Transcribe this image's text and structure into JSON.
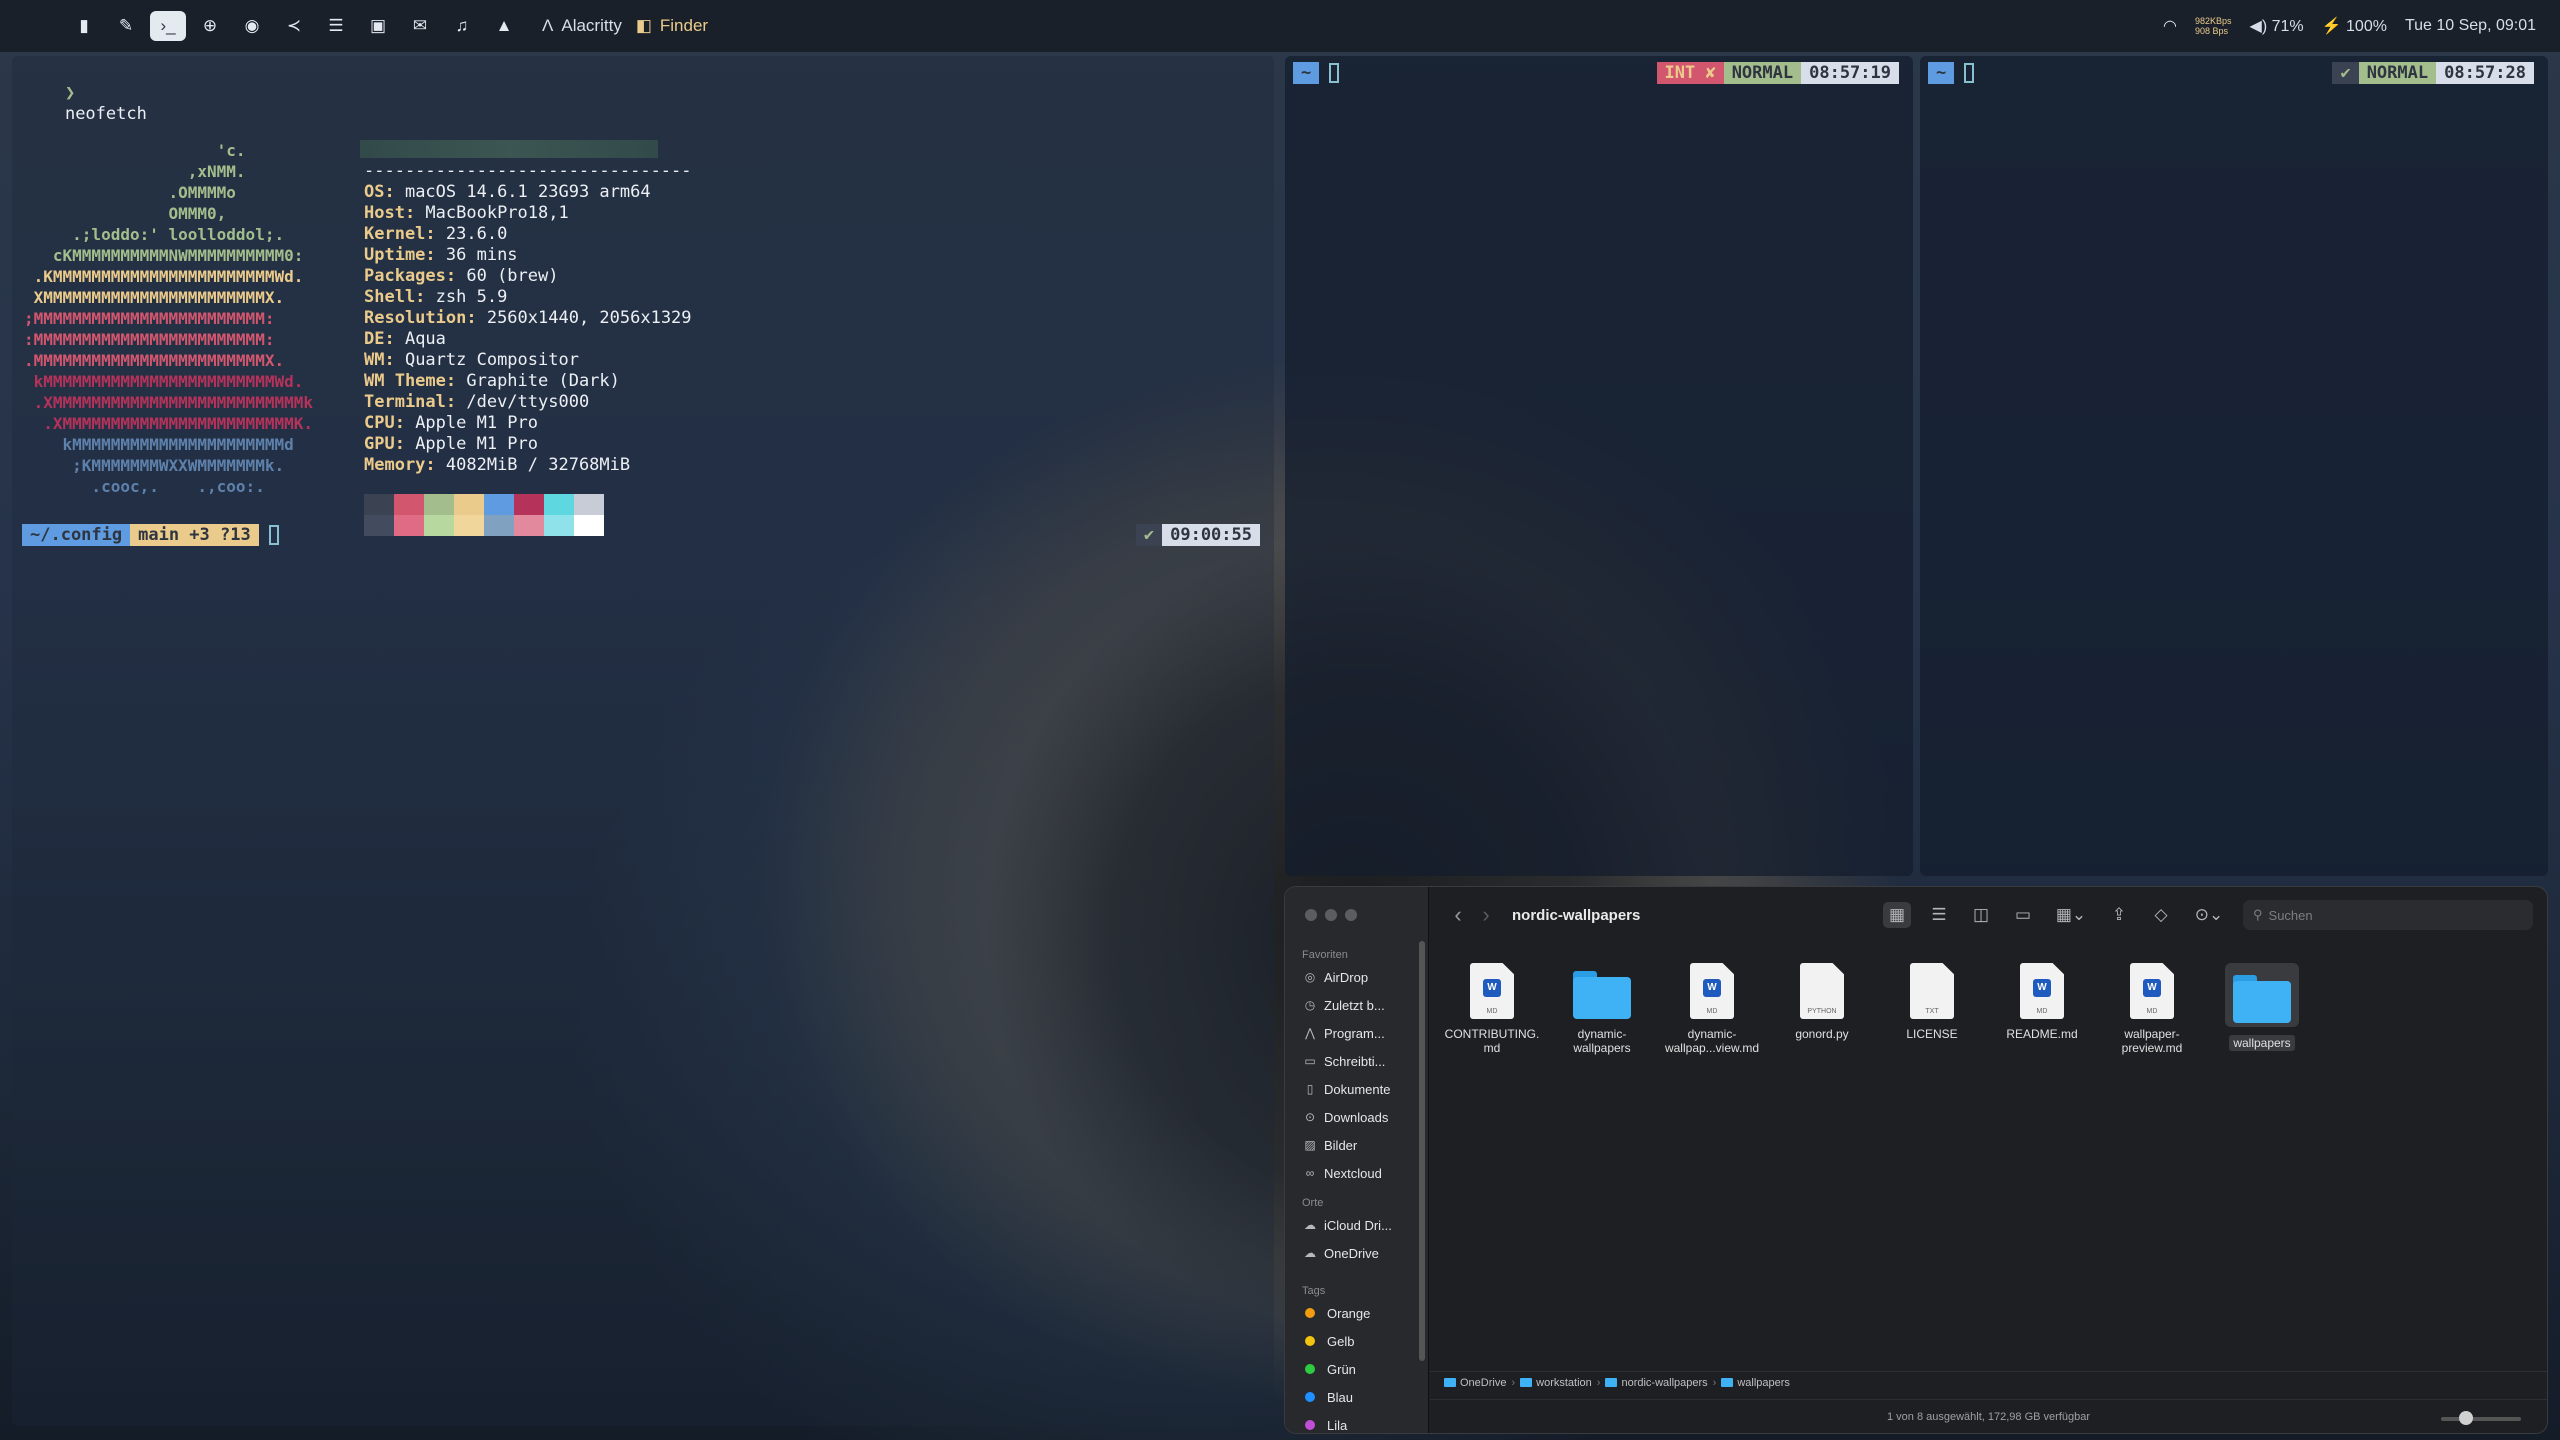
{
  "topbar": {
    "apps": [
      "Alacritty",
      "Finder"
    ],
    "net_up": "982KBps",
    "net_down": "908 Bps",
    "volume": "71%",
    "battery": "100%",
    "datetime": "Tue 10 Sep, 09:01"
  },
  "terminal_left": {
    "prompt_symbol": "❯",
    "command": "neofetch",
    "ascii": [
      "                    'c.",
      "                 ,xNMM.",
      "               .OMMMMo",
      "               OMMM0,",
      "     .;loddo:' loolloddol;.",
      "   cKMMMMMMMMMMNWMMMMMMMMMM0:",
      " .KMMMMMMMMMMMMMMMMMMMMMMMWd.",
      " XMMMMMMMMMMMMMMMMMMMMMMMX.",
      ";MMMMMMMMMMMMMMMMMMMMMMMM:",
      ":MMMMMMMMMMMMMMMMMMMMMMMM:",
      ".MMMMMMMMMMMMMMMMMMMMMMMMX.",
      " kMMMMMMMMMMMMMMMMMMMMMMMMWd.",
      " .XMMMMMMMMMMMMMMMMMMMMMMMMMMk",
      "  .XMMMMMMMMMMMMMMMMMMMMMMMMK.",
      "    kMMMMMMMMMMMMMMMMMMMMMMd",
      "     ;KMMMMMMMWXXWMMMMMMMk.",
      "       .cooc,.    .,coo:."
    ],
    "info": [
      {
        "k": "OS",
        "v": "macOS 14.6.1 23G93 arm64"
      },
      {
        "k": "Host",
        "v": "MacBookPro18,1"
      },
      {
        "k": "Kernel",
        "v": "23.6.0"
      },
      {
        "k": "Uptime",
        "v": "36 mins"
      },
      {
        "k": "Packages",
        "v": "60 (brew)"
      },
      {
        "k": "Shell",
        "v": "zsh 5.9"
      },
      {
        "k": "Resolution",
        "v": "2560x1440, 2056x1329"
      },
      {
        "k": "DE",
        "v": "Aqua"
      },
      {
        "k": "WM",
        "v": "Quartz Compositor"
      },
      {
        "k": "WM Theme",
        "v": "Graphite (Dark)"
      },
      {
        "k": "Terminal",
        "v": "/dev/ttys000"
      },
      {
        "k": "CPU",
        "v": "Apple M1 Pro"
      },
      {
        "k": "GPU",
        "v": "Apple M1 Pro"
      },
      {
        "k": "Memory",
        "v": "4082MiB / 32768MiB"
      }
    ],
    "separator": "--------------------------------",
    "palette_top": [
      "#3b4252",
      "#d3566f",
      "#a3be8c",
      "#ebcb8b",
      "#5e9be0",
      "#b5325a",
      "#5fd7e0",
      "#c7ccd6"
    ],
    "palette_bottom": [
      "#434c5e",
      "#e06b85",
      "#b7d9a0",
      "#f0d69b",
      "#81a1c1",
      "#e3899e",
      "#8fe2ea",
      "#ffffff"
    ],
    "prompt_dir": "~/.config",
    "prompt_git": "main +3 ?13",
    "prompt_time": "09:00:55",
    "prompt_check": "✔"
  },
  "terminal_mid": {
    "dir": "~",
    "status": "INT ✘",
    "mode": "NORMAL",
    "time": "08:57:19"
  },
  "terminal_right": {
    "dir": "~",
    "check": "✔",
    "mode": "NORMAL",
    "time": "08:57:28"
  },
  "finder": {
    "title": "nordic-wallpapers",
    "search_placeholder": "Suchen",
    "sidebar": {
      "favorites_label": "Favoriten",
      "favorites": [
        {
          "label": "AirDrop",
          "icon": "airdrop-icon"
        },
        {
          "label": "Zuletzt b...",
          "icon": "clock-icon"
        },
        {
          "label": "Program...",
          "icon": "apps-icon"
        },
        {
          "label": "Schreibti...",
          "icon": "desktop-icon"
        },
        {
          "label": "Dokumente",
          "icon": "document-icon"
        },
        {
          "label": "Downloads",
          "icon": "download-icon"
        },
        {
          "label": "Bilder",
          "icon": "photo-icon"
        },
        {
          "label": "Nextcloud",
          "icon": "nextcloud-icon"
        }
      ],
      "places_label": "Orte",
      "places": [
        {
          "label": "iCloud Dri...",
          "icon": "cloud-icon"
        },
        {
          "label": "OneDrive",
          "icon": "cloud-icon"
        }
      ],
      "tags_label": "Tags",
      "tags": [
        {
          "label": "Orange",
          "color": "#f39c12"
        },
        {
          "label": "Gelb",
          "color": "#f1c40f"
        },
        {
          "label": "Grün",
          "color": "#2ecc40"
        },
        {
          "label": "Blau",
          "color": "#1e90ff"
        },
        {
          "label": "Lila",
          "color": "#c04fd8"
        }
      ]
    },
    "files": [
      {
        "name": "CONTRIBUTING.\nmd",
        "kind": "word",
        "badge": "MD"
      },
      {
        "name": "dynamic-\nwallpapers",
        "kind": "folder"
      },
      {
        "name": "dynamic-\nwallpap...view.md",
        "kind": "word",
        "badge": "MD"
      },
      {
        "name": "gonord.py",
        "kind": "doc",
        "badge": "PYTHON"
      },
      {
        "name": "LICENSE",
        "kind": "doc",
        "badge": "TXT"
      },
      {
        "name": "README.md",
        "kind": "word",
        "badge": "MD"
      },
      {
        "name": "wallpaper-\npreview.md",
        "kind": "word",
        "badge": "MD"
      },
      {
        "name": "wallpapers",
        "kind": "folder",
        "selected": true
      }
    ],
    "path": [
      "OneDrive",
      "workstation",
      "nordic-wallpapers",
      "wallpapers"
    ],
    "status": "1 von 8 ausgewählt, 172,98 GB verfügbar"
  }
}
